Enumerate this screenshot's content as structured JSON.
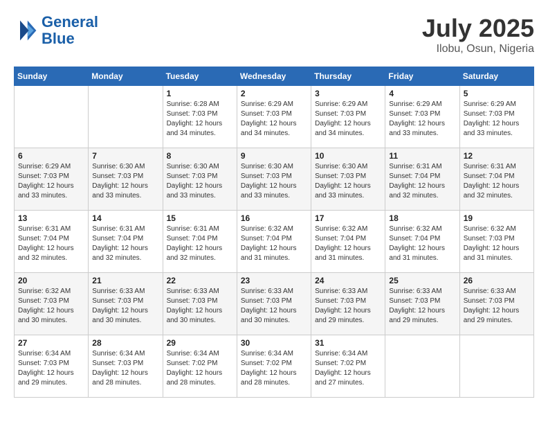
{
  "header": {
    "logo_line1": "General",
    "logo_line2": "Blue",
    "month_year": "July 2025",
    "location": "Ilobu, Osun, Nigeria"
  },
  "weekdays": [
    "Sunday",
    "Monday",
    "Tuesday",
    "Wednesday",
    "Thursday",
    "Friday",
    "Saturday"
  ],
  "weeks": [
    [
      {
        "day": "",
        "info": ""
      },
      {
        "day": "",
        "info": ""
      },
      {
        "day": "1",
        "info": "Sunrise: 6:28 AM\nSunset: 7:03 PM\nDaylight: 12 hours\nand 34 minutes."
      },
      {
        "day": "2",
        "info": "Sunrise: 6:29 AM\nSunset: 7:03 PM\nDaylight: 12 hours\nand 34 minutes."
      },
      {
        "day": "3",
        "info": "Sunrise: 6:29 AM\nSunset: 7:03 PM\nDaylight: 12 hours\nand 34 minutes."
      },
      {
        "day": "4",
        "info": "Sunrise: 6:29 AM\nSunset: 7:03 PM\nDaylight: 12 hours\nand 33 minutes."
      },
      {
        "day": "5",
        "info": "Sunrise: 6:29 AM\nSunset: 7:03 PM\nDaylight: 12 hours\nand 33 minutes."
      }
    ],
    [
      {
        "day": "6",
        "info": "Sunrise: 6:29 AM\nSunset: 7:03 PM\nDaylight: 12 hours\nand 33 minutes."
      },
      {
        "day": "7",
        "info": "Sunrise: 6:30 AM\nSunset: 7:03 PM\nDaylight: 12 hours\nand 33 minutes."
      },
      {
        "day": "8",
        "info": "Sunrise: 6:30 AM\nSunset: 7:03 PM\nDaylight: 12 hours\nand 33 minutes."
      },
      {
        "day": "9",
        "info": "Sunrise: 6:30 AM\nSunset: 7:03 PM\nDaylight: 12 hours\nand 33 minutes."
      },
      {
        "day": "10",
        "info": "Sunrise: 6:30 AM\nSunset: 7:03 PM\nDaylight: 12 hours\nand 33 minutes."
      },
      {
        "day": "11",
        "info": "Sunrise: 6:31 AM\nSunset: 7:04 PM\nDaylight: 12 hours\nand 32 minutes."
      },
      {
        "day": "12",
        "info": "Sunrise: 6:31 AM\nSunset: 7:04 PM\nDaylight: 12 hours\nand 32 minutes."
      }
    ],
    [
      {
        "day": "13",
        "info": "Sunrise: 6:31 AM\nSunset: 7:04 PM\nDaylight: 12 hours\nand 32 minutes."
      },
      {
        "day": "14",
        "info": "Sunrise: 6:31 AM\nSunset: 7:04 PM\nDaylight: 12 hours\nand 32 minutes."
      },
      {
        "day": "15",
        "info": "Sunrise: 6:31 AM\nSunset: 7:04 PM\nDaylight: 12 hours\nand 32 minutes."
      },
      {
        "day": "16",
        "info": "Sunrise: 6:32 AM\nSunset: 7:04 PM\nDaylight: 12 hours\nand 31 minutes."
      },
      {
        "day": "17",
        "info": "Sunrise: 6:32 AM\nSunset: 7:04 PM\nDaylight: 12 hours\nand 31 minutes."
      },
      {
        "day": "18",
        "info": "Sunrise: 6:32 AM\nSunset: 7:04 PM\nDaylight: 12 hours\nand 31 minutes."
      },
      {
        "day": "19",
        "info": "Sunrise: 6:32 AM\nSunset: 7:03 PM\nDaylight: 12 hours\nand 31 minutes."
      }
    ],
    [
      {
        "day": "20",
        "info": "Sunrise: 6:32 AM\nSunset: 7:03 PM\nDaylight: 12 hours\nand 30 minutes."
      },
      {
        "day": "21",
        "info": "Sunrise: 6:33 AM\nSunset: 7:03 PM\nDaylight: 12 hours\nand 30 minutes."
      },
      {
        "day": "22",
        "info": "Sunrise: 6:33 AM\nSunset: 7:03 PM\nDaylight: 12 hours\nand 30 minutes."
      },
      {
        "day": "23",
        "info": "Sunrise: 6:33 AM\nSunset: 7:03 PM\nDaylight: 12 hours\nand 30 minutes."
      },
      {
        "day": "24",
        "info": "Sunrise: 6:33 AM\nSunset: 7:03 PM\nDaylight: 12 hours\nand 29 minutes."
      },
      {
        "day": "25",
        "info": "Sunrise: 6:33 AM\nSunset: 7:03 PM\nDaylight: 12 hours\nand 29 minutes."
      },
      {
        "day": "26",
        "info": "Sunrise: 6:33 AM\nSunset: 7:03 PM\nDaylight: 12 hours\nand 29 minutes."
      }
    ],
    [
      {
        "day": "27",
        "info": "Sunrise: 6:34 AM\nSunset: 7:03 PM\nDaylight: 12 hours\nand 29 minutes."
      },
      {
        "day": "28",
        "info": "Sunrise: 6:34 AM\nSunset: 7:03 PM\nDaylight: 12 hours\nand 28 minutes."
      },
      {
        "day": "29",
        "info": "Sunrise: 6:34 AM\nSunset: 7:02 PM\nDaylight: 12 hours\nand 28 minutes."
      },
      {
        "day": "30",
        "info": "Sunrise: 6:34 AM\nSunset: 7:02 PM\nDaylight: 12 hours\nand 28 minutes."
      },
      {
        "day": "31",
        "info": "Sunrise: 6:34 AM\nSunset: 7:02 PM\nDaylight: 12 hours\nand 27 minutes."
      },
      {
        "day": "",
        "info": ""
      },
      {
        "day": "",
        "info": ""
      }
    ]
  ]
}
